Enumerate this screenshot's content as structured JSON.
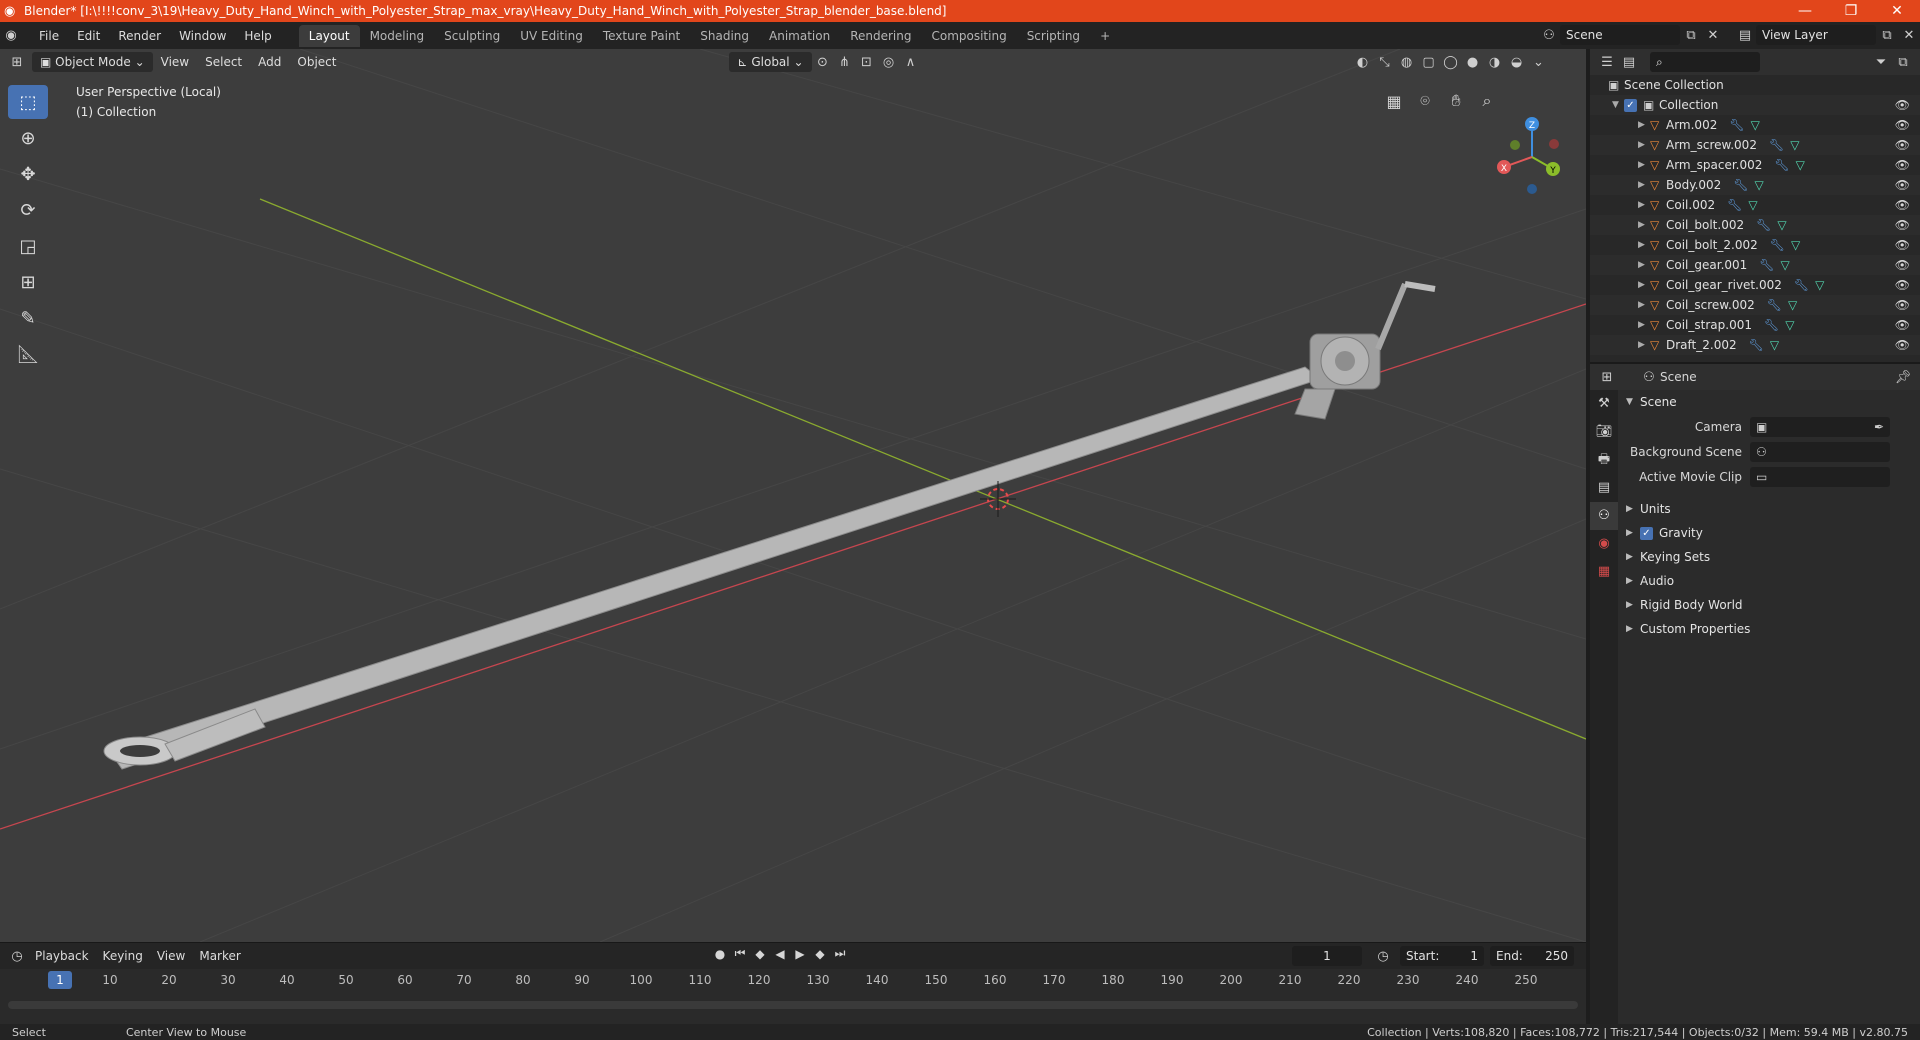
{
  "window": {
    "title": "Blender* [I:\\!!!!conv_3\\19\\Heavy_Duty_Hand_Winch_with_Polyester_Strap_max_vray\\Heavy_Duty_Hand_Winch_with_Polyester_Strap_blender_base.blend]",
    "minimize": "—",
    "maximize": "❐",
    "close": "✕"
  },
  "menu": [
    "File",
    "Edit",
    "Render",
    "Window",
    "Help"
  ],
  "workspaces": [
    "Layout",
    "Modeling",
    "Sculpting",
    "UV Editing",
    "Texture Paint",
    "Shading",
    "Animation",
    "Rendering",
    "Compositing",
    "Scripting"
  ],
  "workspace_add": "+",
  "scene_field": "Scene",
  "view_layer_field": "View Layer",
  "viewport": {
    "mode": "Object Mode",
    "menus": [
      "View",
      "Select",
      "Add",
      "Object"
    ],
    "transform_orientation": "Global",
    "perspective_label": "User Perspective (Local)",
    "collection_label": "(1) Collection",
    "gizmo": {
      "x": "X",
      "y": "Y",
      "z": "Z"
    },
    "background": "#3d3d3d"
  },
  "timeline": {
    "menus": [
      "Playback",
      "Keying",
      "View",
      "Marker"
    ],
    "current_frame": "1",
    "start_label": "Start:",
    "start": "1",
    "end_label": "End:",
    "end": "250",
    "ticks": [
      "10",
      "20",
      "30",
      "40",
      "50",
      "60",
      "70",
      "80",
      "90",
      "100",
      "110",
      "120",
      "130",
      "140",
      "150",
      "160",
      "170",
      "180",
      "190",
      "200",
      "210",
      "220",
      "230",
      "240",
      "250"
    ]
  },
  "outliner": {
    "root": "Scene Collection",
    "collection": "Collection",
    "items": [
      "Arm.002",
      "Arm_screw.002",
      "Arm_spacer.002",
      "Body.002",
      "Coil.002",
      "Coil_bolt.002",
      "Coil_bolt_2.002",
      "Coil_gear.001",
      "Coil_gear_rivet.002",
      "Coil_screw.002",
      "Coil_strap.001",
      "Draft_2.002"
    ]
  },
  "properties": {
    "context": "Scene",
    "panel_title": "Scene",
    "camera_label": "Camera",
    "background_scene_label": "Background Scene",
    "active_movie_clip_label": "Active Movie Clip",
    "collapsed_panels": [
      "Units",
      "Gravity",
      "Keying Sets",
      "Audio",
      "Rigid Body World",
      "Custom Properties"
    ]
  },
  "status": {
    "left_select": "Select",
    "left_center": "Center View to Mouse",
    "right": "Collection | Verts:108,820 | Faces:108,772 | Tris:217,544 | Objects:0/32 | Mem: 59.4 MB | v2.80.75"
  },
  "colors": {
    "accent": "#4772b3",
    "titlebar": "#e2461b",
    "x_axis": "#c6464f",
    "y_axis": "#8aaa2f"
  }
}
